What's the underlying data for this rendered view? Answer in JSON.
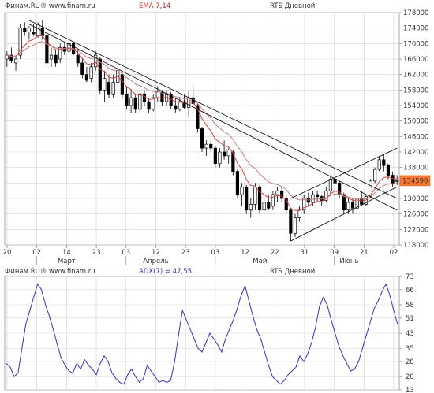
{
  "main_panel": {
    "source": "Финам.RU® www.finam.ru",
    "indicator": "EMA 7,14",
    "title": "RTS Дневной",
    "last_price": "134590",
    "colors": {
      "candle_up": "#ffffff",
      "candle_down": "#000000",
      "ema7": "#e04040",
      "ema14": "#c08080",
      "trend": "#000000",
      "price_box": "#ff7733"
    }
  },
  "adx_panel": {
    "source": "Финам.RU® www.finam.ru",
    "indicator": "ADX(7) = 47,55",
    "title": "RTS Дневной",
    "colors": {
      "line": "#3333bb"
    }
  },
  "chart_data": [
    {
      "type": "candlestick",
      "title": "RTS Дневной",
      "ylim": [
        118000,
        178000
      ],
      "y_ticks": [
        118000,
        122000,
        126000,
        130000,
        134000,
        138000,
        142000,
        146000,
        150000,
        154000,
        158000,
        162000,
        166000,
        170000,
        174000,
        178000
      ],
      "x_tick_labels": [
        "20",
        "02",
        "14",
        "23",
        "03",
        "12",
        "23",
        "03",
        "12",
        "22",
        "31",
        "09",
        "21",
        "02"
      ],
      "month_labels": [
        "Март",
        "Апрель",
        "Май",
        "Июнь"
      ],
      "candles": [
        {
          "o": 166000,
          "h": 168000,
          "l": 164000,
          "c": 167000
        },
        {
          "o": 167000,
          "h": 169000,
          "l": 165000,
          "c": 165500
        },
        {
          "o": 165000,
          "h": 167000,
          "l": 163000,
          "c": 166000
        },
        {
          "o": 167000,
          "h": 175000,
          "l": 166000,
          "c": 174000
        },
        {
          "o": 174000,
          "h": 175500,
          "l": 172000,
          "c": 173000
        },
        {
          "o": 173000,
          "h": 174500,
          "l": 171000,
          "c": 174000
        },
        {
          "o": 173000,
          "h": 175000,
          "l": 172000,
          "c": 172500
        },
        {
          "o": 172000,
          "h": 175500,
          "l": 171500,
          "c": 175000
        },
        {
          "o": 174000,
          "h": 176000,
          "l": 171000,
          "c": 172000
        },
        {
          "o": 172000,
          "h": 172500,
          "l": 164000,
          "c": 165000
        },
        {
          "o": 166000,
          "h": 169000,
          "l": 164000,
          "c": 167000
        },
        {
          "o": 167000,
          "h": 168500,
          "l": 164000,
          "c": 165000
        },
        {
          "o": 166000,
          "h": 170000,
          "l": 165000,
          "c": 169000
        },
        {
          "o": 169000,
          "h": 170500,
          "l": 167000,
          "c": 168000
        },
        {
          "o": 168000,
          "h": 171000,
          "l": 167000,
          "c": 170000
        },
        {
          "o": 170000,
          "h": 170500,
          "l": 167000,
          "c": 167500
        },
        {
          "o": 167000,
          "h": 168500,
          "l": 164000,
          "c": 165000
        },
        {
          "o": 165000,
          "h": 166000,
          "l": 161000,
          "c": 162000
        },
        {
          "o": 162000,
          "h": 164000,
          "l": 160000,
          "c": 160500
        },
        {
          "o": 161000,
          "h": 165000,
          "l": 160000,
          "c": 164000
        },
        {
          "o": 164000,
          "h": 168000,
          "l": 163000,
          "c": 167000
        },
        {
          "o": 166000,
          "h": 166500,
          "l": 157000,
          "c": 158000
        },
        {
          "o": 158000,
          "h": 163000,
          "l": 155000,
          "c": 161000
        },
        {
          "o": 160000,
          "h": 162000,
          "l": 156000,
          "c": 157000
        },
        {
          "o": 157000,
          "h": 162000,
          "l": 156000,
          "c": 160000
        },
        {
          "o": 160000,
          "h": 164000,
          "l": 159000,
          "c": 163000
        },
        {
          "o": 162000,
          "h": 162500,
          "l": 156000,
          "c": 157000
        },
        {
          "o": 157000,
          "h": 159000,
          "l": 153000,
          "c": 154000
        },
        {
          "o": 154000,
          "h": 158000,
          "l": 152000,
          "c": 156000
        },
        {
          "o": 156000,
          "h": 157000,
          "l": 152000,
          "c": 153000
        },
        {
          "o": 153000,
          "h": 158000,
          "l": 152000,
          "c": 157000
        },
        {
          "o": 157000,
          "h": 158000,
          "l": 154000,
          "c": 155000
        },
        {
          "o": 155000,
          "h": 156000,
          "l": 152000,
          "c": 153000
        },
        {
          "o": 153000,
          "h": 157000,
          "l": 152500,
          "c": 156000
        },
        {
          "o": 156000,
          "h": 159000,
          "l": 155000,
          "c": 157500
        },
        {
          "o": 157500,
          "h": 158000,
          "l": 154000,
          "c": 155000
        },
        {
          "o": 155000,
          "h": 158000,
          "l": 154000,
          "c": 157000
        },
        {
          "o": 157000,
          "h": 157500,
          "l": 153000,
          "c": 154000
        },
        {
          "o": 154000,
          "h": 156000,
          "l": 152000,
          "c": 153000
        },
        {
          "o": 153000,
          "h": 156000,
          "l": 152500,
          "c": 155000
        },
        {
          "o": 155000,
          "h": 157000,
          "l": 153000,
          "c": 153500
        },
        {
          "o": 153500,
          "h": 158000,
          "l": 151000,
          "c": 156000
        },
        {
          "o": 156000,
          "h": 159000,
          "l": 154000,
          "c": 154500
        },
        {
          "o": 154000,
          "h": 154500,
          "l": 147000,
          "c": 148000
        },
        {
          "o": 148000,
          "h": 148500,
          "l": 142000,
          "c": 143000
        },
        {
          "o": 143000,
          "h": 145000,
          "l": 141000,
          "c": 144000
        },
        {
          "o": 144000,
          "h": 145500,
          "l": 142000,
          "c": 143000
        },
        {
          "o": 143000,
          "h": 143500,
          "l": 138000,
          "c": 139000
        },
        {
          "o": 139000,
          "h": 143000,
          "l": 138000,
          "c": 142000
        },
        {
          "o": 142000,
          "h": 145000,
          "l": 140000,
          "c": 141000
        },
        {
          "o": 141000,
          "h": 143000,
          "l": 139000,
          "c": 142500
        },
        {
          "o": 142000,
          "h": 142500,
          "l": 136000,
          "c": 137000
        },
        {
          "o": 137000,
          "h": 137500,
          "l": 130000,
          "c": 131000
        },
        {
          "o": 131000,
          "h": 134000,
          "l": 128000,
          "c": 133000
        },
        {
          "o": 133000,
          "h": 133500,
          "l": 126000,
          "c": 127000
        },
        {
          "o": 127000,
          "h": 130000,
          "l": 125000,
          "c": 128500
        },
        {
          "o": 128500,
          "h": 134000,
          "l": 127000,
          "c": 133000
        },
        {
          "o": 133000,
          "h": 133500,
          "l": 126000,
          "c": 127000
        },
        {
          "o": 127000,
          "h": 130000,
          "l": 125000,
          "c": 129000
        },
        {
          "o": 129000,
          "h": 131000,
          "l": 127000,
          "c": 127500
        },
        {
          "o": 128000,
          "h": 132000,
          "l": 127000,
          "c": 131000
        },
        {
          "o": 131000,
          "h": 133000,
          "l": 129000,
          "c": 132000
        },
        {
          "o": 132000,
          "h": 133000,
          "l": 129000,
          "c": 130000
        },
        {
          "o": 130000,
          "h": 131000,
          "l": 126000,
          "c": 127000
        },
        {
          "o": 127000,
          "h": 127500,
          "l": 119000,
          "c": 121000
        },
        {
          "o": 121000,
          "h": 126000,
          "l": 120000,
          "c": 125000
        },
        {
          "o": 125000,
          "h": 128000,
          "l": 124000,
          "c": 127000
        },
        {
          "o": 127000,
          "h": 131000,
          "l": 126000,
          "c": 130000
        },
        {
          "o": 130000,
          "h": 131500,
          "l": 128000,
          "c": 129000
        },
        {
          "o": 129000,
          "h": 132000,
          "l": 128000,
          "c": 131000
        },
        {
          "o": 131000,
          "h": 132000,
          "l": 129000,
          "c": 130500
        },
        {
          "o": 130500,
          "h": 131000,
          "l": 128000,
          "c": 129500
        },
        {
          "o": 129500,
          "h": 133000,
          "l": 129000,
          "c": 132000
        },
        {
          "o": 132000,
          "h": 136000,
          "l": 131000,
          "c": 135000
        },
        {
          "o": 135000,
          "h": 137000,
          "l": 133000,
          "c": 134000
        },
        {
          "o": 134000,
          "h": 134500,
          "l": 130000,
          "c": 131000
        },
        {
          "o": 131000,
          "h": 131500,
          "l": 126000,
          "c": 127000
        },
        {
          "o": 127000,
          "h": 130000,
          "l": 126000,
          "c": 129000
        },
        {
          "o": 129000,
          "h": 130000,
          "l": 126000,
          "c": 127500
        },
        {
          "o": 127500,
          "h": 131000,
          "l": 127000,
          "c": 130000
        },
        {
          "o": 130000,
          "h": 132000,
          "l": 128000,
          "c": 128500
        },
        {
          "o": 128500,
          "h": 131000,
          "l": 128000,
          "c": 130500
        },
        {
          "o": 130500,
          "h": 135000,
          "l": 130000,
          "c": 134500
        },
        {
          "o": 134500,
          "h": 138000,
          "l": 134000,
          "c": 137500
        },
        {
          "o": 137500,
          "h": 141000,
          "l": 137000,
          "c": 140000
        },
        {
          "o": 140000,
          "h": 141500,
          "l": 137000,
          "c": 138500
        },
        {
          "o": 138500,
          "h": 139000,
          "l": 135000,
          "c": 136000
        },
        {
          "o": 136000,
          "h": 137000,
          "l": 133000,
          "c": 134000
        },
        {
          "o": 134500,
          "h": 136000,
          "l": 133500,
          "c": 134590
        }
      ],
      "trend_lines": [
        {
          "from": [
            5,
            176000
          ],
          "to": [
            88,
            130000
          ]
        },
        {
          "from": [
            5,
            175000
          ],
          "to": [
            88,
            127000
          ]
        },
        {
          "from": [
            64,
            119000
          ],
          "to": [
            88,
            133000
          ]
        },
        {
          "from": [
            64,
            130000
          ],
          "to": [
            88,
            143000
          ]
        }
      ]
    },
    {
      "type": "line",
      "title": "RTS Дневной",
      "series": [
        {
          "name": "ADX(7)",
          "values": [
            27,
            25,
            20,
            22,
            35,
            48,
            55,
            62,
            69,
            66,
            58,
            52,
            45,
            37,
            30,
            26,
            23,
            22,
            27,
            24,
            29,
            26,
            24,
            21,
            27,
            31,
            28,
            22,
            19,
            17,
            16,
            21,
            24,
            20,
            17,
            19,
            26,
            23,
            20,
            17,
            18,
            17,
            18,
            28,
            42,
            55,
            50,
            45,
            40,
            35,
            33,
            38,
            43,
            40,
            37,
            33,
            40,
            45,
            50,
            56,
            63,
            68,
            60,
            52,
            45,
            40,
            33,
            26,
            20,
            18,
            16,
            18,
            21,
            23,
            25,
            31,
            28,
            32,
            38,
            46,
            57,
            62,
            58,
            50,
            43,
            36,
            31,
            27,
            23,
            24,
            28,
            35,
            42,
            49,
            56,
            60,
            65,
            69,
            63,
            55,
            47.55
          ]
        }
      ],
      "ylim": [
        13,
        73
      ],
      "y_ticks": [
        13,
        20,
        28,
        35,
        43,
        51,
        58,
        66,
        73
      ]
    }
  ]
}
